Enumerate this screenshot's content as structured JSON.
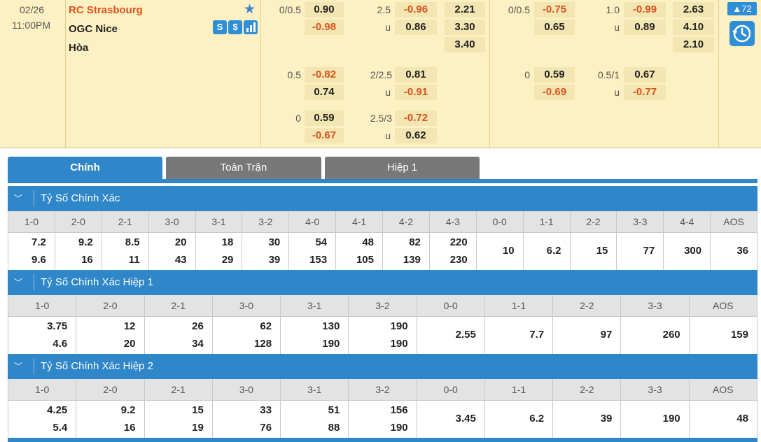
{
  "match": {
    "date": "02/26",
    "time": "11:00PM",
    "home_team": "RC Strasbourg",
    "away_team": "OGC Nice",
    "draw_label": "Hòa",
    "icons": [
      "favorite-star-icon",
      "stats-s-icon",
      "money-icon",
      "bar-chart-icon"
    ],
    "badge_count": "▲72",
    "lines": [
      {
        "ah_ft_line": "0/0.5",
        "ah_ft_home": "0.90",
        "ah_ft_away": "-0.98",
        "ou_ft_line": "2.5",
        "ou_ft_under_label": "u",
        "ou_ft_over": "-0.96",
        "ou_ft_under": "0.86",
        "x12_ft": [
          "2.21",
          "3.30",
          "3.40"
        ],
        "ah_h1_line": "0/0.5",
        "ah_h1_home": "-0.75",
        "ah_h1_away": "0.65",
        "ou_h1_line": "1.0",
        "ou_h1_under_label": "u",
        "ou_h1_over": "-0.99",
        "ou_h1_under": "0.89",
        "x12_h1": [
          "2.63",
          "4.10",
          "2.10"
        ]
      },
      {
        "ah_ft_line": "0.5",
        "ah_ft_home": "-0.82",
        "ah_ft_away": "0.74",
        "ou_ft_line": "2/2.5",
        "ou_ft_under_label": "u",
        "ou_ft_over": "0.81",
        "ou_ft_under": "-0.91",
        "ah_h1_line": "0",
        "ah_h1_home": "0.59",
        "ah_h1_away": "-0.69",
        "ou_h1_line": "0.5/1",
        "ou_h1_under_label": "u",
        "ou_h1_over": "0.67",
        "ou_h1_under": "-0.77"
      },
      {
        "ah_ft_line": "0",
        "ah_ft_home": "0.59",
        "ah_ft_away": "-0.67",
        "ou_ft_line": "2.5/3",
        "ou_ft_under_label": "u",
        "ou_ft_over": "-0.72",
        "ou_ft_under": "0.62"
      }
    ]
  },
  "colors": {
    "accent": "#2f86c8",
    "negative": "#d9531e",
    "match_bg": "#fdf0c2",
    "home_team": "#e0531c",
    "inactive_tab": "#787878"
  },
  "tabs": [
    "Chính",
    "Toàn Trận",
    "Hiệp 1"
  ],
  "sections": [
    {
      "title": "Tỷ Số Chính Xác",
      "headers": [
        "1-0",
        "2-0",
        "2-1",
        "3-0",
        "3-1",
        "3-2",
        "4-0",
        "4-1",
        "4-2",
        "4-3",
        "0-0",
        "1-1",
        "2-2",
        "3-3",
        "4-4",
        "AOS"
      ],
      "home": [
        "7.2",
        "9.2",
        "8.5",
        "20",
        "18",
        "30",
        "54",
        "48",
        "82",
        "220"
      ],
      "away": [
        "9.6",
        "16",
        "11",
        "43",
        "29",
        "39",
        "153",
        "105",
        "139",
        "230"
      ],
      "draws": [
        "10",
        "6.2",
        "15",
        "77",
        "300",
        "36"
      ]
    },
    {
      "title": "Tỷ Số Chính Xác Hiệp 1",
      "headers": [
        "1-0",
        "2-0",
        "2-1",
        "3-0",
        "3-1",
        "3-2",
        "0-0",
        "1-1",
        "2-2",
        "3-3",
        "AOS"
      ],
      "home": [
        "3.75",
        "12",
        "26",
        "62",
        "130",
        "190"
      ],
      "away": [
        "4.6",
        "20",
        "34",
        "128",
        "190",
        "190"
      ],
      "draws": [
        "2.55",
        "7.7",
        "97",
        "260",
        "159"
      ]
    },
    {
      "title": "Tỷ Số Chính Xác Hiệp 2",
      "headers": [
        "1-0",
        "2-0",
        "2-1",
        "3-0",
        "3-1",
        "3-2",
        "0-0",
        "1-1",
        "2-2",
        "3-3",
        "AOS"
      ],
      "home": [
        "4.25",
        "9.2",
        "15",
        "33",
        "51",
        "156"
      ],
      "away": [
        "5.4",
        "16",
        "19",
        "76",
        "88",
        "190"
      ],
      "draws": [
        "3.45",
        "6.2",
        "39",
        "190",
        "48"
      ]
    }
  ]
}
